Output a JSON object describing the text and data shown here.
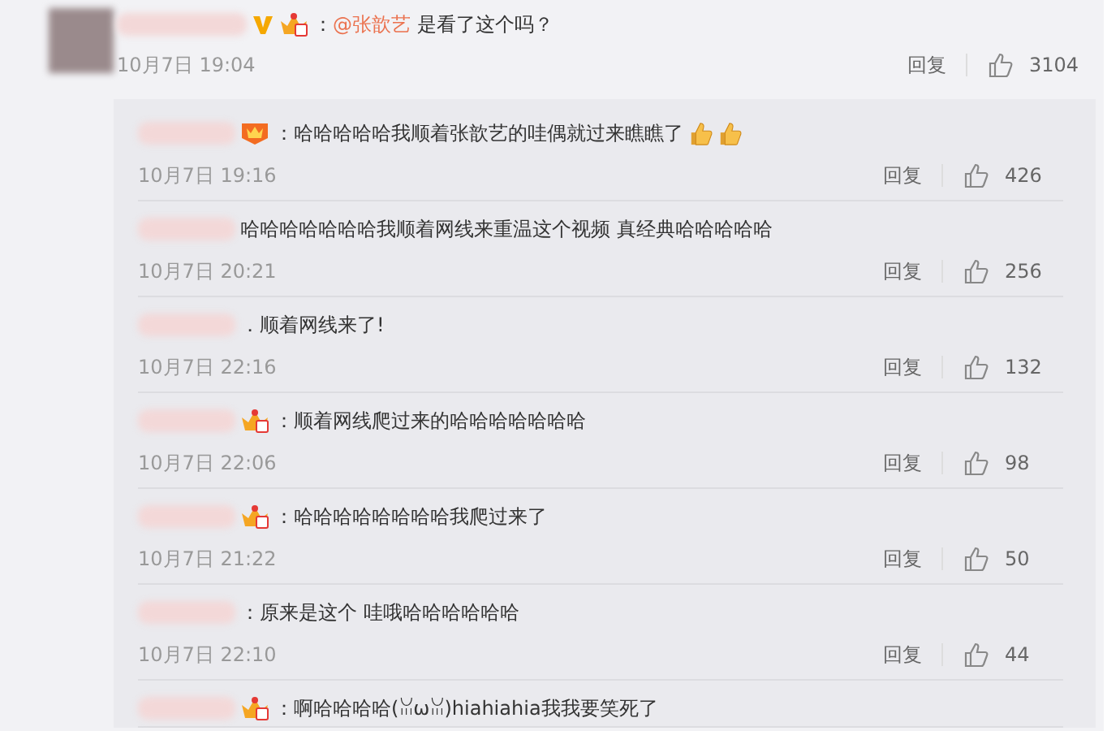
{
  "comment": {
    "badges": [
      {
        "kind": "verified"
      },
      {
        "kind": "crown"
      }
    ],
    "prefix": "：",
    "mention": "@张歆艺",
    "text": " 是看了这个吗？",
    "time": "10月7日 19:04",
    "reply_label": "回复",
    "likes": "3104"
  },
  "replies": [
    {
      "badge": {
        "kind": "vip"
      },
      "text": "：哈哈哈哈哈我顺着张歆艺的哇偶就过来瞧瞧了",
      "emoji": [
        {
          "kind": "thumbs-up"
        },
        {
          "kind": "thumbs-up"
        }
      ],
      "time": "10月7日 19:16",
      "reply_label": "回复",
      "likes": "426"
    },
    {
      "text": "哈哈哈哈哈哈哈我顺着网线来重温这个视频 真经典哈哈哈哈哈",
      "time": "10月7日 20:21",
      "reply_label": "回复",
      "likes": "256"
    },
    {
      "text": "．顺着网线来了!",
      "time": "10月7日 22:16",
      "reply_label": "回复",
      "likes": "132"
    },
    {
      "badge": {
        "kind": "crown"
      },
      "text": "：顺着网线爬过来的哈哈哈哈哈哈哈",
      "time": "10月7日 22:06",
      "reply_label": "回复",
      "likes": "98"
    },
    {
      "badge": {
        "kind": "crown"
      },
      "text": "：哈哈哈哈哈哈哈哈我爬过来了",
      "time": "10月7日 21:22",
      "reply_label": "回复",
      "likes": "50"
    },
    {
      "text": "：原来是这个 哇哦哈哈哈哈哈哈",
      "time": "10月7日 22:10",
      "reply_label": "回复",
      "likes": "44"
    },
    {
      "badge": {
        "kind": "crown"
      },
      "text": "：啊哈哈哈哈(ꈍωꈍ)hiahiahia我我要笑死了"
    }
  ]
}
